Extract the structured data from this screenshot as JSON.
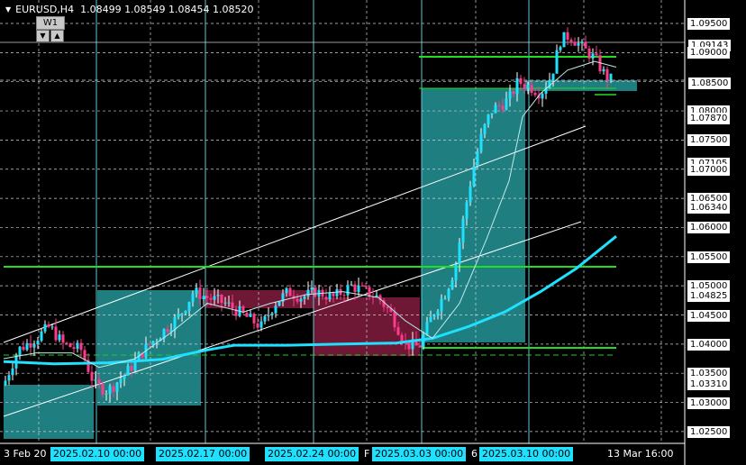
{
  "header": {
    "symbol": "EURUSD,H4",
    "ohlc": "1.08499 1.08549 1.08454 1.08520",
    "timeframe_button": "W1"
  },
  "price_axis": {
    "labels": [
      "1.09500",
      "1.09143",
      "1.09000",
      "1.08500",
      "1.08000",
      "1.07870",
      "1.07500",
      "1.07105",
      "1.07000",
      "1.06500",
      "1.06340",
      "1.06000",
      "1.05500",
      "1.05000",
      "1.04825",
      "1.04500",
      "1.04000",
      "1.03500",
      "1.03310",
      "1.03000",
      "1.02500"
    ],
    "highlight": [
      "1.09143",
      "1.08500"
    ]
  },
  "time_axis": {
    "labels": [
      "3 Feb 20",
      "2025.02.10 00:00",
      "2025.02.17 00:00",
      "2025.02.24 00:00",
      "F",
      "2025.03.03 00:00",
      "6",
      "2025.03.10 00:00",
      "13 Mar 16:00"
    ],
    "highlighted": [
      "2025.02.10 00:00",
      "2025.02.17 00:00",
      "2025.02.24 00:00",
      "2025.03.03 00:00",
      "2025.03.10 00:00"
    ]
  },
  "chart_data": {
    "type": "candlestick",
    "y_range": [
      1.0225,
      1.0975
    ],
    "colors": {
      "bull": "#1fe0ff",
      "bear": "#ff3b8c",
      "ma_slow": "#1fe0ff",
      "ma_fast": "#8fe0e0",
      "zone_green": "#00e000",
      "box_teal": "#1f8a8a",
      "box_maroon": "#7a1a3a"
    },
    "horizontal_levels": [
      1.095,
      1.0914,
      1.085,
      1.0553,
      1.0389,
      1.0378
    ],
    "candles": []
  }
}
